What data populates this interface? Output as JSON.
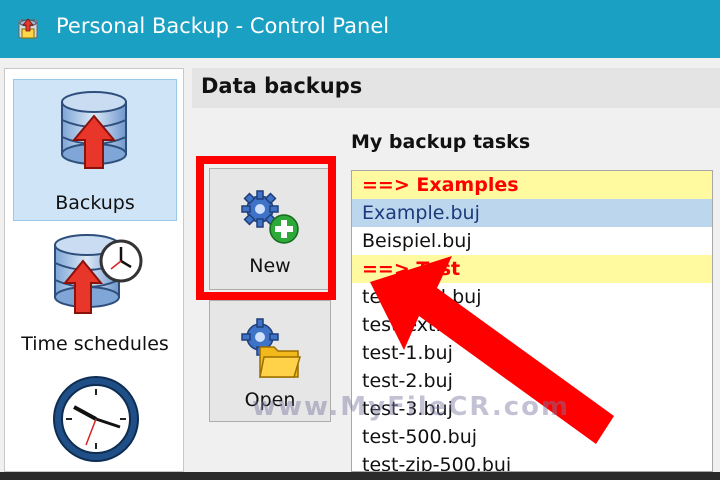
{
  "window": {
    "title": "Personal Backup - Control Panel"
  },
  "sidebar": {
    "items": [
      {
        "label": "Backups",
        "icon": "database-upload-icon",
        "selected": true
      },
      {
        "label": "Time schedules",
        "icon": "database-clock-icon",
        "selected": false
      },
      {
        "label": "",
        "icon": "clock-icon",
        "selected": false
      }
    ]
  },
  "main": {
    "section_title": "Data backups",
    "tasks_label": "My backup tasks",
    "buttons": {
      "new_label": "New",
      "open_label": "Open"
    },
    "tasks": [
      {
        "text": "==> Examples",
        "type": "group"
      },
      {
        "text": "Example.buj",
        "type": "item",
        "selected": true
      },
      {
        "text": "Beispiel.buj",
        "type": "item"
      },
      {
        "text": "==> Test",
        "type": "group"
      },
      {
        "text": "test-mail.buj",
        "type": "item"
      },
      {
        "text": "test-ext.buj",
        "type": "item"
      },
      {
        "text": "test-1.buj",
        "type": "item"
      },
      {
        "text": "test-2.buj",
        "type": "item"
      },
      {
        "text": "test-3.buj",
        "type": "item"
      },
      {
        "text": "test-500.buj",
        "type": "item"
      },
      {
        "text": "test-zip-500.buj",
        "type": "item"
      }
    ]
  },
  "overlay": {
    "watermark": "www.MyFileCR.com"
  },
  "colors": {
    "titlebar": "#1aa0c2",
    "highlight": "#ff0000",
    "group_background": "#fff9a0",
    "selected_row": "#bcd6ee"
  }
}
